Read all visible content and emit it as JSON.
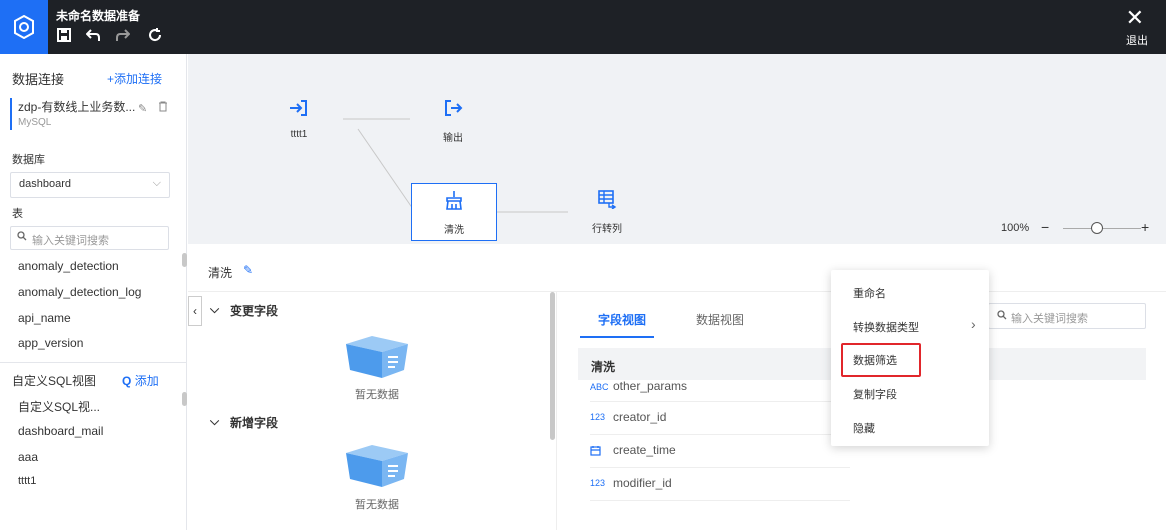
{
  "header": {
    "title": "未命名数据准备",
    "close_label": "退出",
    "icons": [
      "save-icon",
      "undo-icon",
      "redo-icon",
      "refresh-icon"
    ]
  },
  "sidebar": {
    "connections_title": "数据连接",
    "add_connection": "+添加连接",
    "connection": {
      "name": "zdp-有数线上业务数...",
      "type": "MySQL"
    },
    "database_title": "数据库",
    "database_value": "dashboard",
    "table_title": "表",
    "search_placeholder": "输入关键词搜索",
    "tables": [
      "anomaly_detection",
      "anomaly_detection_log",
      "api_name",
      "app_version"
    ],
    "custom_sql_title": "自定义SQL视图",
    "custom_sql_add": "添加",
    "custom_sql_items": [
      "自定义SQL视...",
      "dashboard_mail",
      "aaa",
      "tttt1"
    ]
  },
  "canvas": {
    "nodes": [
      {
        "label": "tttt1",
        "icon": "input-icon"
      },
      {
        "label": "输出",
        "icon": "output-icon"
      },
      {
        "label": "清洗",
        "icon": "clean-icon"
      },
      {
        "label": "行转列",
        "icon": "pivot-icon"
      }
    ],
    "zoom": "100%"
  },
  "panel": {
    "title": "清洗",
    "group_changed": "变更字段",
    "group_added": "新增字段",
    "empty_text": "暂无数据",
    "tabs": [
      "字段视图",
      "数据视图"
    ],
    "search_placeholder": "输入关键词搜索",
    "table_header": "清洗",
    "fields": [
      {
        "type": "ABC",
        "name": "other_params"
      },
      {
        "type": "123",
        "name": "creator_id"
      },
      {
        "type": "date",
        "name": "create_time"
      },
      {
        "type": "123",
        "name": "modifier_id"
      }
    ]
  },
  "context_menu": {
    "items": [
      "重命名",
      "转换数据类型",
      "数据筛选",
      "复制字段",
      "隐藏"
    ]
  },
  "colors": {
    "accent": "#1e6ff5",
    "topbar": "#1e2126",
    "highlight": "#e1262b"
  }
}
